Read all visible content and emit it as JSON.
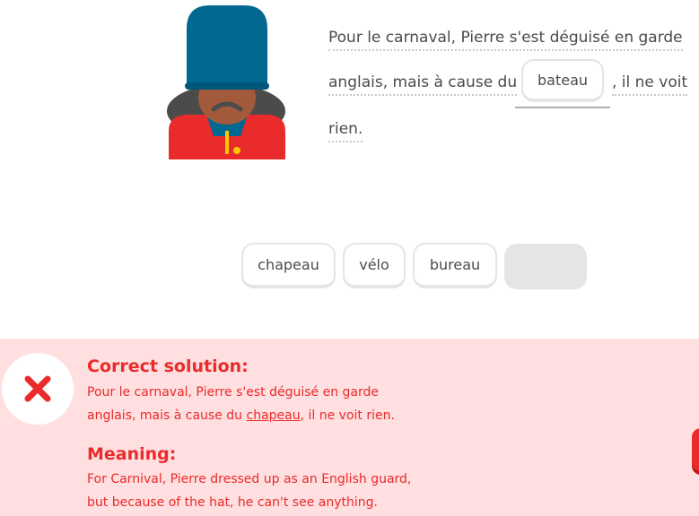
{
  "sentence": {
    "line1": "Pour le carnaval, Pierre s'est déguisé en garde",
    "line2_before": "anglais, mais à cause du",
    "answer": "bateau",
    "line2_after": ", il ne voit",
    "line3": "rien."
  },
  "word_bank": [
    "chapeau",
    "vélo",
    "bureau"
  ],
  "feedback": {
    "icon": "close-icon",
    "correct_title": "Correct solution:",
    "correct_line1": "Pour le carnaval, Pierre s'est déguisé en garde",
    "correct_line2_before": "anglais, mais à cause du ",
    "correct_word": "chapeau",
    "correct_line2_after": ", il ne voit rien.",
    "meaning_title": "Meaning:",
    "meaning_line1": "For Carnival, Pierre dressed up as an English guard,",
    "meaning_line2": "but because of the hat, he can't see anything."
  },
  "colors": {
    "error_red": "#ea2b2b",
    "feedback_bg": "#ffdfe0",
    "guard_hat": "#006891",
    "guard_coat": "#ea2b2b"
  }
}
